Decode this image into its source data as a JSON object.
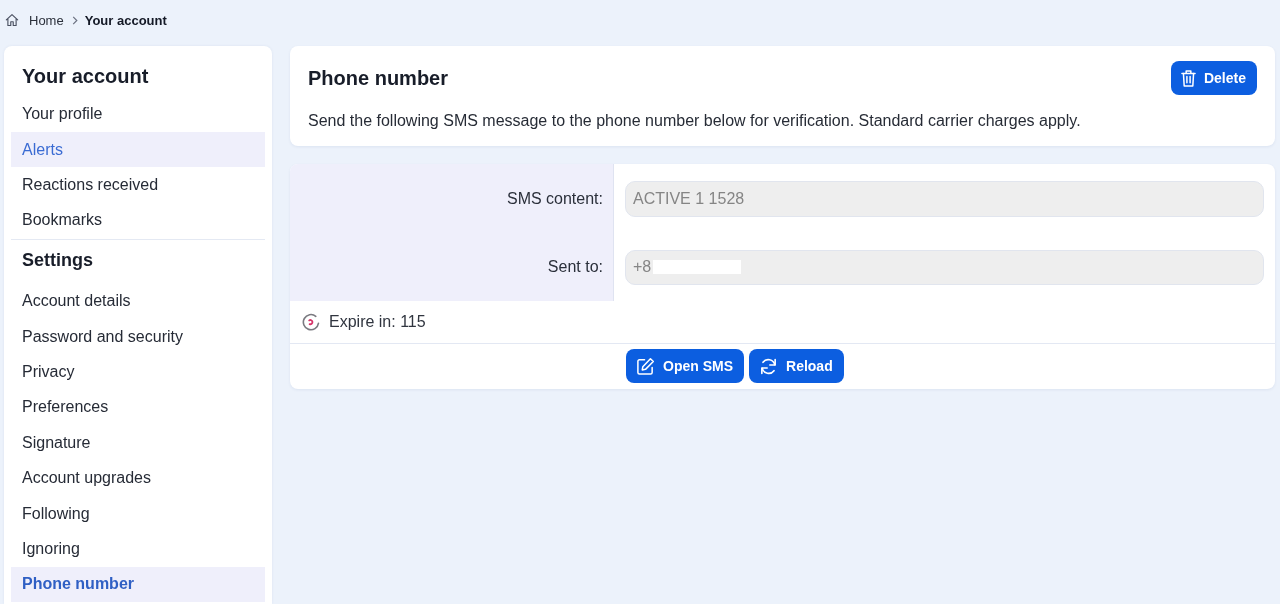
{
  "breadcrumb": [
    {
      "label": "Home",
      "kind": "home",
      "current": false
    },
    {
      "label": "Your account",
      "kind": "page",
      "current": true
    }
  ],
  "sidebar": {
    "title": "Your account",
    "items": [
      {
        "label": "Your profile",
        "selected": false,
        "hovered": false
      },
      {
        "label": "Alerts",
        "selected": false,
        "hovered": true
      },
      {
        "label": "Reactions received",
        "selected": false,
        "hovered": false
      },
      {
        "label": "Bookmarks",
        "selected": false,
        "hovered": false
      }
    ],
    "sections": [
      {
        "title": "Settings",
        "items": [
          {
            "label": "Account details",
            "selected": false,
            "hovered": false
          },
          {
            "label": "Password and security",
            "selected": false,
            "hovered": false
          },
          {
            "label": "Privacy",
            "selected": false,
            "hovered": false
          },
          {
            "label": "Preferences",
            "selected": false,
            "hovered": false
          },
          {
            "label": "Signature",
            "selected": false,
            "hovered": false
          },
          {
            "label": "Account upgrades",
            "selected": false,
            "hovered": false
          },
          {
            "label": "Following",
            "selected": false,
            "hovered": false
          },
          {
            "label": "Ignoring",
            "selected": false,
            "hovered": false
          },
          {
            "label": "Phone number",
            "selected": true,
            "hovered": false
          }
        ]
      }
    ]
  },
  "header": {
    "title": "Phone number",
    "description": "Send the following SMS message to the phone number below for verification. Standard carrier charges apply.",
    "delete_button": "Delete"
  },
  "form": {
    "fields": [
      {
        "label": "SMS content:",
        "value": "ACTIVE 1 1528",
        "redacted": false
      },
      {
        "label": "Sent to:",
        "value": "+8",
        "redacted": true
      }
    ],
    "expiry": "Expire in: 115",
    "buttons": [
      {
        "label": "Open SMS",
        "kind": "open-sms"
      },
      {
        "label": "Reload",
        "kind": "reload"
      }
    ]
  }
}
